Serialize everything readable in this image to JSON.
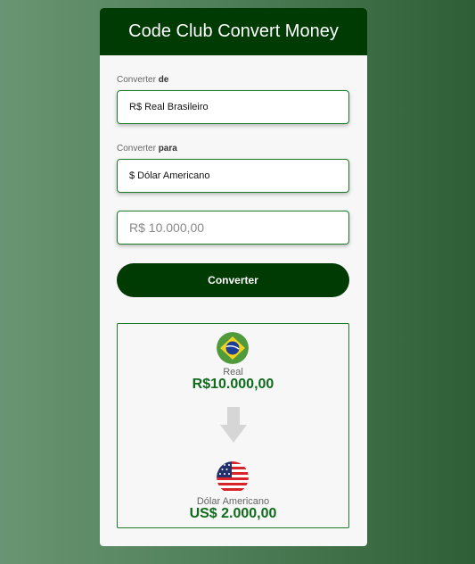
{
  "header": {
    "title": "Code Club Convert Money"
  },
  "from": {
    "label_prefix": "Converter ",
    "label_bold": "de",
    "selected": "R$ Real Brasileiro"
  },
  "to": {
    "label_prefix": "Converter ",
    "label_bold": "para",
    "selected": "$ Dólar Americano"
  },
  "amount": {
    "placeholder": "R$ 10.000,00",
    "value": ""
  },
  "button": {
    "label": "Converter"
  },
  "result": {
    "source": {
      "name": "Real",
      "value": "R$10.000,00",
      "flag": "brazil-flag-icon"
    },
    "arrow_icon": "arrow-down-icon",
    "target": {
      "name": "Dólar Americano",
      "value": "US$ 2.000,00",
      "flag": "usa-flag-icon"
    }
  },
  "colors": {
    "header_bg": "#003b04",
    "border": "#1f7a2a",
    "value_text": "#0f6b1c"
  }
}
